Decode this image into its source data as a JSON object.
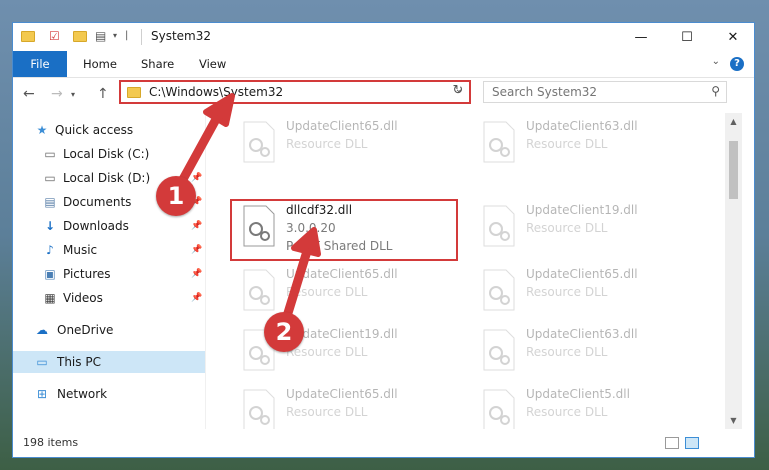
{
  "window": {
    "title": "System32",
    "controls": {
      "minimize": "—",
      "maximize": "☐",
      "close": "✕"
    }
  },
  "ribbon": {
    "tabs": [
      {
        "label": "File"
      },
      {
        "label": "Home"
      },
      {
        "label": "Share"
      },
      {
        "label": "View"
      }
    ],
    "help_label": "?"
  },
  "navigation": {
    "back_icon": "←",
    "forward_icon": "→",
    "up_icon": "↑",
    "path": "C:\\Windows\\System32",
    "search_placeholder": "Search System32"
  },
  "sidebar": {
    "items": [
      {
        "label": "Quick access",
        "icon": "star-icon"
      },
      {
        "label": "Local Disk (C:)",
        "icon": "drive-icon"
      },
      {
        "label": "Local Disk (D:)",
        "icon": "drive-icon"
      },
      {
        "label": "Documents",
        "icon": "documents-icon"
      },
      {
        "label": "Downloads",
        "icon": "download-icon"
      },
      {
        "label": "Music",
        "icon": "music-icon"
      },
      {
        "label": "Pictures",
        "icon": "pictures-icon"
      },
      {
        "label": "Videos",
        "icon": "video-icon"
      },
      {
        "label": "OneDrive",
        "icon": "cloud-icon"
      },
      {
        "label": "This PC",
        "icon": "computer-icon"
      },
      {
        "label": "Network",
        "icon": "network-icon"
      }
    ]
  },
  "files": [
    {
      "name": "UpdateClient65.dll",
      "desc": "Resource DLL"
    },
    {
      "name": "UpdateClient63.dll",
      "desc": "Resource DLL"
    },
    {
      "name": "dllcdf32.dll",
      "version": "3.0.0.20",
      "desc": "PoINT Shared DLL"
    },
    {
      "name": "UpdateClient19.dll",
      "desc": "Resource DLL"
    },
    {
      "name": "UpdateClient65.dll",
      "desc": "Resource DLL"
    },
    {
      "name": "UpdateClient65.dll",
      "desc": "Resource DLL"
    },
    {
      "name": "UpdateClient19.dll",
      "desc": "Resource DLL"
    },
    {
      "name": "UpdateClient63.dll",
      "desc": "Resource DLL"
    },
    {
      "name": "UpdateClient65.dll",
      "desc": "Resource DLL"
    },
    {
      "name": "UpdateClient5.dll",
      "desc": "Resource DLL"
    }
  ],
  "status": {
    "item_count": "198 items"
  },
  "callouts": [
    {
      "label": "1"
    },
    {
      "label": "2"
    }
  ],
  "colors": {
    "accent": "#1a6fc5",
    "highlight": "#d33a3a",
    "selection": "#cde6f7"
  }
}
